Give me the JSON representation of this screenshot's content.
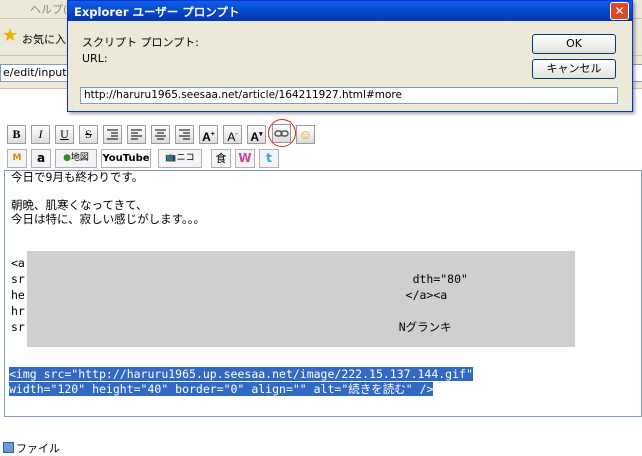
{
  "menu": {
    "help": "ヘルプ(H)"
  },
  "favorites": {
    "label": "お気に入"
  },
  "address": {
    "value": "e/edit/input?"
  },
  "toolbar1": {
    "bold": "B",
    "italic": "I",
    "underline": "U",
    "strike": "S",
    "font_up": "A",
    "font_down": "A",
    "font_color": "A"
  },
  "toolbar2": {
    "amazon": "a",
    "map": "地図",
    "youtube": "YouTube",
    "nico": "ニコ",
    "food": "食",
    "w": "W",
    "twitter": "t"
  },
  "editor": {
    "line1": "今日で9月も終わりです。",
    "line2": "朝晩、肌寒くなってきて、",
    "line3": "今日は特に、寂しい感じがします。。。",
    "line4": "<a",
    "line5": "sr                                                        dth=\"80\"",
    "line6": "he                                                       </a><a",
    "line7": "hr",
    "line8": "sr                                                      Nグランキ",
    "sel1": "<img src=\"http://haruru1965.up.seesaa.net/image/222.15.137.144.gif\"",
    "sel2": "width=\"120\" height=\"40\" border=\"0\" align=\"\" alt=\"続きを読む\" />"
  },
  "bottom": {
    "label": "ファイル"
  },
  "dialog": {
    "title": "Explorer ユーザー プロンプト",
    "close": "✕",
    "prompt_label": "スクリプト プロンプト:",
    "prompt_text": "URL:",
    "ok": "OK",
    "cancel": "キャンセル",
    "input_value": "http://haruru1965.seesaa.net/article/164211927.html#more"
  }
}
